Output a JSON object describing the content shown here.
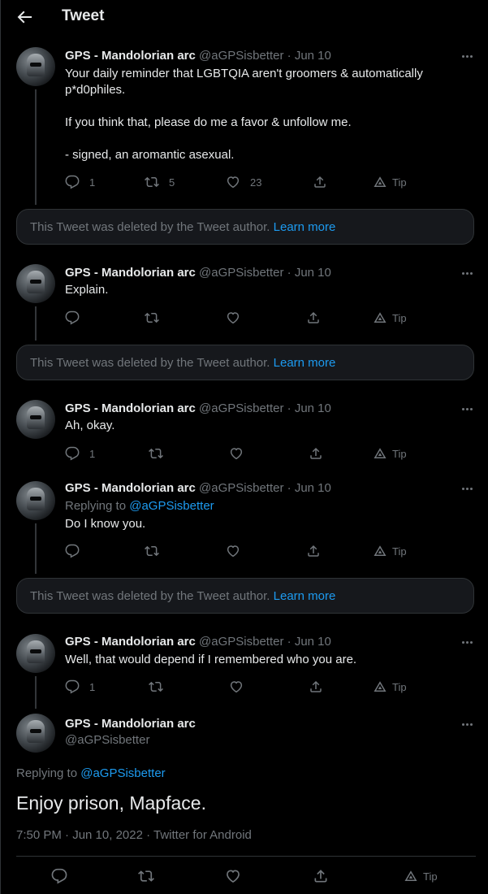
{
  "header": {
    "title": "Tweet"
  },
  "deleted_notice": {
    "text": "This Tweet was deleted by the Tweet author.",
    "link": "Learn more"
  },
  "tip_label": "Tip",
  "tweets": [
    {
      "name": "GPS - Mandolorian arc",
      "handle": "@aGPSisbetter",
      "date": "Jun 10",
      "text": "Your daily reminder that LGBTQIA aren't groomers & automatically p*d0philes.\n\nIf you think that, please do me a favor & unfollow me.\n\n- signed, an aromantic asexual.",
      "replies": "1",
      "retweets": "5",
      "likes": "23"
    },
    {
      "name": "GPS - Mandolorian arc",
      "handle": "@aGPSisbetter",
      "date": "Jun 10",
      "text": "Explain.",
      "replies": "",
      "retweets": "",
      "likes": ""
    },
    {
      "name": "GPS - Mandolorian arc",
      "handle": "@aGPSisbetter",
      "date": "Jun 10",
      "text": "Ah, okay.",
      "replies": "1",
      "retweets": "",
      "likes": ""
    },
    {
      "name": "GPS - Mandolorian arc",
      "handle": "@aGPSisbetter",
      "date": "Jun 10",
      "replying_prefix": "Replying to",
      "replying_to": "@aGPSisbetter",
      "text": "Do I know you.",
      "replies": "",
      "retweets": "",
      "likes": ""
    },
    {
      "name": "GPS - Mandolorian arc",
      "handle": "@aGPSisbetter",
      "date": "Jun 10",
      "text": "Well, that would depend if I remembered who you are.",
      "replies": "1",
      "retweets": "",
      "likes": ""
    }
  ],
  "main_tweet": {
    "name": "GPS - Mandolorian arc",
    "handle": "@aGPSisbetter",
    "replying_prefix": "Replying to",
    "replying_to": "@aGPSisbetter",
    "text": "Enjoy prison, Mapface.",
    "timestamp": "7:50 PM · Jun 10, 2022 · Twitter for Android"
  },
  "icons": {
    "back": "arrow-left-icon",
    "more": "more-horizontal-icon",
    "reply": "reply-icon",
    "retweet": "retweet-icon",
    "like": "heart-icon",
    "share": "share-icon",
    "tip": "tip-icon"
  },
  "colors": {
    "background": "#000000",
    "text": "#e7e9ea",
    "muted": "#71767b",
    "link": "#1d9bf0",
    "border": "#2f3336"
  }
}
